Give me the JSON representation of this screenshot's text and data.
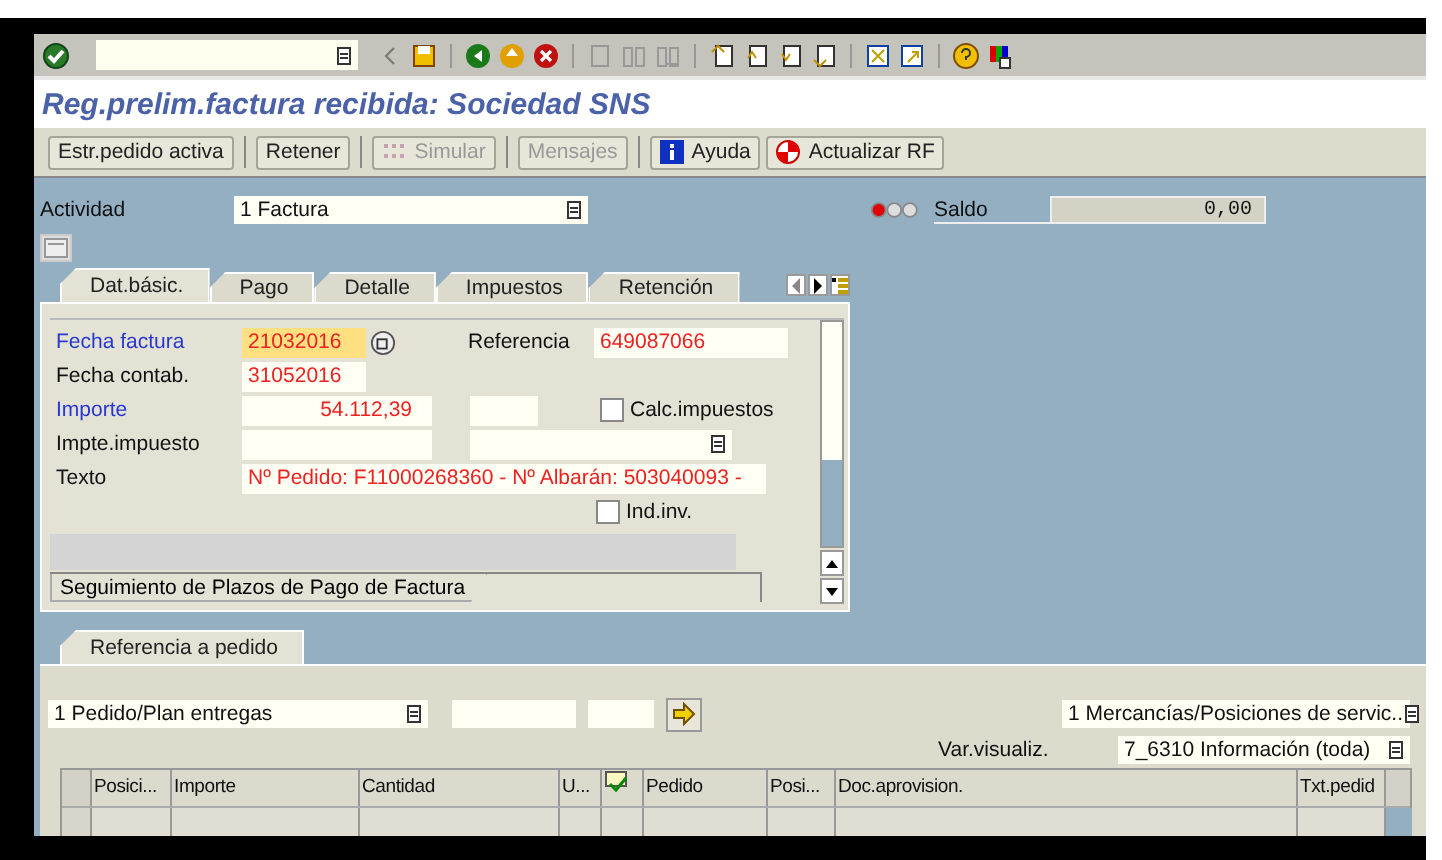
{
  "title": "Reg.prelim.factura recibida: Sociedad SNS",
  "app_buttons": [
    {
      "label": "Estr.pedido activa",
      "kind": "text",
      "disabled": false
    },
    {
      "label": "Retener",
      "kind": "text",
      "disabled": false
    },
    {
      "label": "Simular",
      "kind": "grid",
      "disabled": true
    },
    {
      "label": "Mensajes",
      "kind": "text",
      "disabled": true
    },
    {
      "label": "Ayuda",
      "kind": "info",
      "disabled": false
    },
    {
      "label": "Actualizar RF",
      "kind": "refresh",
      "disabled": false
    }
  ],
  "activity": {
    "label": "Actividad",
    "value": "1 Factura"
  },
  "balance": {
    "label": "Saldo",
    "value": "0,00",
    "status_light": true
  },
  "tabs": [
    {
      "label": "Dat.básic.",
      "selected": true
    },
    {
      "label": "Pago",
      "selected": false
    },
    {
      "label": "Detalle",
      "selected": false
    },
    {
      "label": "Impuestos",
      "selected": false
    },
    {
      "label": "Retención",
      "selected": false
    }
  ],
  "fields": {
    "invoice_date": {
      "label": "Fecha factura",
      "value": "21032016",
      "required": true,
      "focused": true
    },
    "reference": {
      "label": "Referencia",
      "value": "649087066"
    },
    "posting_date": {
      "label": "Fecha contab.",
      "value": "31052016",
      "required": false
    },
    "amount": {
      "label": "Importe",
      "value": "54.112,39",
      "required": true
    },
    "calc_tax": {
      "label": "Calc.impuestos",
      "checked": false
    },
    "tax_amount": {
      "label": "Impte.impuesto",
      "required": false
    },
    "text": {
      "label": "Texto",
      "value": "Nº Pedido: F11000268360 - Nº Albarán: 503040093 -",
      "required": false
    },
    "ind_inv": {
      "label": "Ind.inv.",
      "checked": false
    }
  },
  "subtab": {
    "label": "Seguimiento de Plazos de Pago de Factura"
  },
  "bottom": {
    "tab": {
      "label": "Referencia a pedido",
      "selected": true
    },
    "reference_type": {
      "value": "1 Pedido/Plan entregas"
    },
    "item_type": {
      "value": "1 Mercancías/Posiciones de servic.."
    },
    "layout": {
      "label": "Var.visualiz.",
      "value": "7_6310 Información (toda)"
    },
    "table": {
      "columns": [
        {
          "label": "Posici...",
          "kind": "text"
        },
        {
          "label": "Importe",
          "kind": "text"
        },
        {
          "label": "Cantidad",
          "kind": "text"
        },
        {
          "label": "U...",
          "kind": "text"
        },
        {
          "kind": "check-icon"
        },
        {
          "label": "Pedido",
          "kind": "text"
        },
        {
          "label": "Posi...",
          "kind": "text"
        },
        {
          "label": "Doc.aprovision.",
          "kind": "text"
        },
        {
          "label": "Txt.pedid",
          "kind": "text"
        }
      ]
    }
  }
}
